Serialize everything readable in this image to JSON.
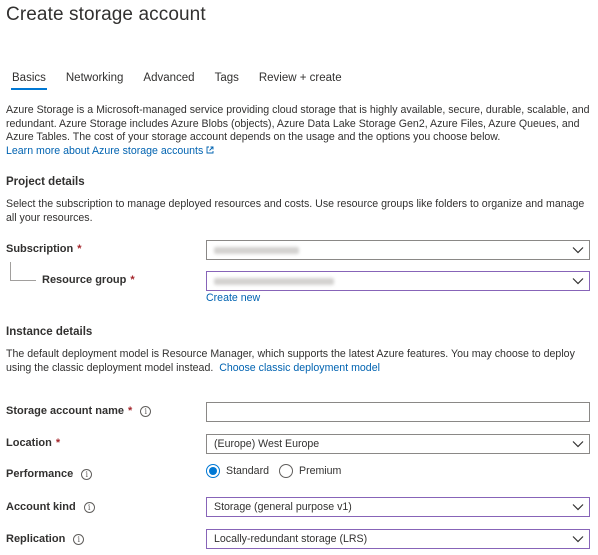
{
  "page": {
    "title": "Create storage account"
  },
  "tabs": [
    {
      "label": "Basics",
      "active": true
    },
    {
      "label": "Networking"
    },
    {
      "label": "Advanced"
    },
    {
      "label": "Tags"
    },
    {
      "label": "Review + create"
    }
  ],
  "intro": {
    "text": "Azure Storage is a Microsoft-managed service providing cloud storage that is highly available, secure, durable, scalable, and redundant. Azure Storage includes Azure Blobs (objects), Azure Data Lake Storage Gen2, Azure Files, Azure Queues, and Azure Tables. The cost of your storage account depends on the usage and the options you choose below.",
    "learn_more": "Learn more about Azure storage accounts"
  },
  "project_details": {
    "heading": "Project details",
    "description": "Select the subscription to manage deployed resources and costs. Use resource groups like folders to organize and manage all your resources.",
    "subscription_label": "Subscription",
    "resource_group_label": "Resource group",
    "required_mark": "*",
    "create_new": "Create new"
  },
  "instance_details": {
    "heading": "Instance details",
    "description": "The default deployment model is Resource Manager, which supports the latest Azure features. You may choose to deploy using the classic deployment model instead.",
    "classic_link": "Choose classic deployment model",
    "storage_name_label": "Storage account name",
    "storage_name_value": "",
    "location_label": "Location",
    "location_value": "(Europe) West Europe",
    "performance_label": "Performance",
    "performance_options": [
      "Standard",
      "Premium"
    ],
    "performance_selected": "Standard",
    "account_kind_label": "Account kind",
    "account_kind_value": "Storage (general purpose v1)",
    "replication_label": "Replication",
    "replication_value": "Locally-redundant storage (LRS)"
  },
  "icons": {
    "info": "i"
  },
  "colors": {
    "accent": "#0078d4",
    "link": "#0063b1",
    "required": "#a4262c",
    "focus_border": "#8764b8"
  }
}
